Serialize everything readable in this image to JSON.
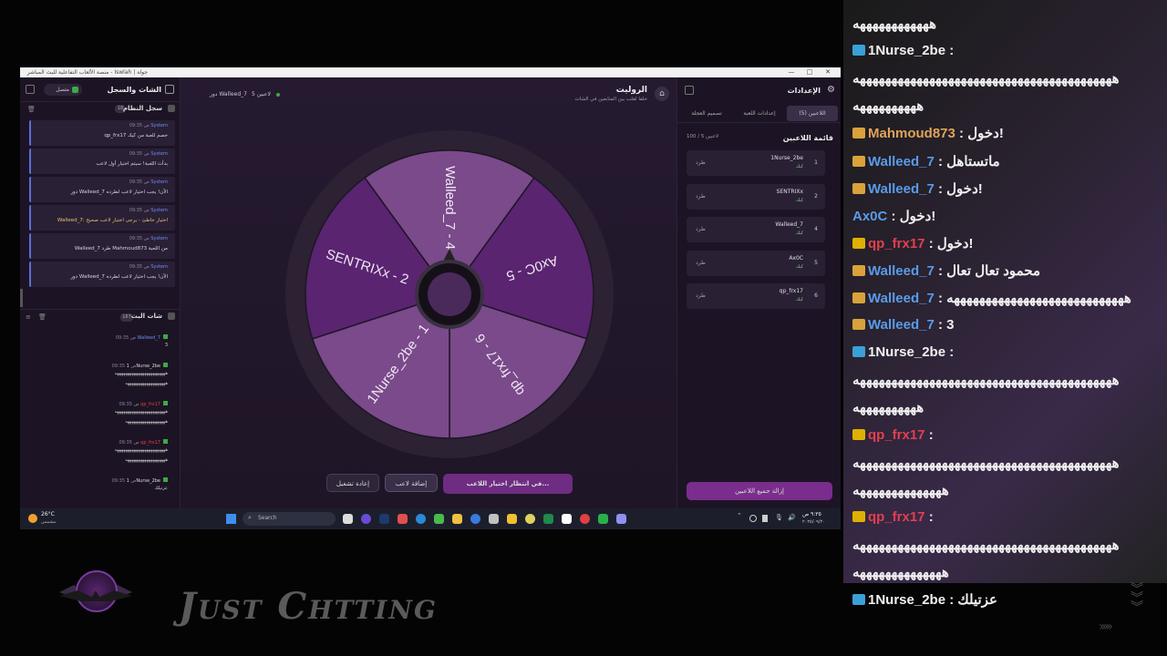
{
  "window": {
    "title": "منصة الألعاب التفاعلية للبث المباشر - Iswlah | جولة",
    "min": "—",
    "max": "□",
    "close": "✕"
  },
  "left": {
    "chat_title": "الشات والسجل",
    "status": "متصل",
    "system_log_title": "سجل النظام",
    "system_log_count": "18",
    "logs": [
      {
        "src": "System",
        "time": "09:35 ص",
        "msg": "qp_frx17 خصم للعبة من كيك"
      },
      {
        "src": "System",
        "time": "09:35 ص",
        "msg": "بدأت اللعبة! سيتم اختيار أول لاعب"
      },
      {
        "src": "System",
        "time": "09:35 ص",
        "msg": "دور Walleed_7 الآن! يجب اختيار لاعب لطرده"
      },
      {
        "src": "System",
        "time": "09:35 ص",
        "msg": "Walleed_7: اختيار خاطئ - يرجى اختيار لاعب صحيح"
      },
      {
        "src": "System",
        "time": "09:35 ص",
        "msg": "Walleed_7 طرد Mahmoud873 من اللعبة"
      },
      {
        "src": "System",
        "time": "09:35 ص",
        "msg": "دور Walleed_7 الآن! يجب اختيار لاعب لطرده"
      }
    ],
    "bot_chat_title": "شات البث",
    "bot_chat_count": "167",
    "chats": [
      {
        "user": "Walleed_7",
        "time": "09:35 ص",
        "lines": [
          "3"
        ]
      },
      {
        "user": "1Nurse_2be",
        "time": "09:35 ص",
        "lines": [
          "ههههههههههههههههههههههههه",
          "هههههههههههههههههههه"
        ]
      },
      {
        "user": "qp_frx17",
        "time": "09:35 ص",
        "lines": [
          "ههههههههههههههههههههههههه",
          "هههههههههههههههههههه"
        ]
      },
      {
        "user": "qp_frx17",
        "time": "09:35 ص",
        "lines": [
          "ههههههههههههههههههههههههه",
          "هههههههههههههههههههه"
        ]
      },
      {
        "user": "1Nurse_2be",
        "time": "09:35 ص",
        "lines": [
          "عزتيلك"
        ]
      }
    ]
  },
  "center": {
    "title": "الروليت",
    "subtitle": "خلفا لقلب بين المتابعين في الشات",
    "players_online": "5 لاعبين",
    "turn": "دور Walleed_7",
    "wheel_segments": [
      "Walleed_7 - 4",
      "Ax0C - 5",
      "qp_frx17 - 6",
      "1Nurse_2be - 1",
      "SENTRIXx - 2"
    ],
    "btn_restart": "إعادة تشغيل",
    "btn_add": "إضافة لاعب",
    "btn_waiting": "في انتظار اختيار اللاعب..."
  },
  "right": {
    "settings_title": "الإعدادات",
    "tabs": [
      "اللاعبين (5)",
      "إعدادات اللعبة",
      "تصميم العجلة"
    ],
    "list_title": "قائمة اللاعبين",
    "list_count": "100 / 5 لاعبين",
    "players": [
      {
        "idx": "1",
        "name": "1Nurse_2be",
        "src": "كيك",
        "kick": "طرد"
      },
      {
        "idx": "2",
        "name": "SENTRIXx",
        "src": "كيك",
        "kick": "طرد"
      },
      {
        "idx": "4",
        "name": "Walleed_7",
        "src": "كيك",
        "kick": "طرد"
      },
      {
        "idx": "5",
        "name": "Ax0C",
        "src": "كيك",
        "kick": "طرد"
      },
      {
        "idx": "6",
        "name": "qp_frx17",
        "src": "كيك",
        "kick": "طرد"
      }
    ],
    "remove_all": "إزالة جميع اللاعبين"
  },
  "taskbar": {
    "weather_temp": "26°C",
    "weather_desc": "مشمس",
    "search": "Search",
    "time": "٩:٣٥ ص",
    "date": "٢٠٢٥/٠٩/٢٠"
  },
  "stream_chat": [
    {
      "user": "",
      "text": "ههههههههههههه",
      "color": "#f0f0f0"
    },
    {
      "user": "1Nurse_2be",
      "text": "",
      "color": "#f0f0f0",
      "badge": "kick"
    },
    {
      "user": "",
      "text": "هههههههههههههههههههههههههههههههههههههههههه",
      "color": "#f0f0f0"
    },
    {
      "user": "",
      "text": "ههههههههههه",
      "color": "#f0f0f0"
    },
    {
      "user": "Mahmoud873",
      "text": "دخول!",
      "color": "#e0a35a",
      "badge": "crown"
    },
    {
      "user": "Walleed_7",
      "text": "ماتستاهل",
      "color": "#5a9be8",
      "badge": "crown"
    },
    {
      "user": "Walleed_7",
      "text": "دخول!",
      "color": "#5a9be8",
      "badge": "crown"
    },
    {
      "user": "Ax0C",
      "text": "دخول!",
      "color": "#5a9be8"
    },
    {
      "user": "qp_frx17",
      "text": "دخول!",
      "color": "#e04050",
      "badge": "sub"
    },
    {
      "user": "Walleed_7",
      "text": "محمود تعال تعال",
      "color": "#5a9be8",
      "badge": "crown"
    },
    {
      "user": "Walleed_7",
      "text": "ههههههههههههههههههههههههههههه",
      "color": "#5a9be8",
      "badge": "crown"
    },
    {
      "user": "Walleed_7",
      "text": "3",
      "color": "#5a9be8",
      "badge": "crown"
    },
    {
      "user": "1Nurse_2be",
      "text": "",
      "color": "#f0f0f0",
      "badge": "kick"
    },
    {
      "user": "",
      "text": "هههههههههههههههههههههههههههههههههههههههههه",
      "color": "#f0f0f0"
    },
    {
      "user": "",
      "text": "ههههههههههه",
      "color": "#f0f0f0"
    },
    {
      "user": "qp_frx17",
      "text": "",
      "color": "#e04050",
      "badge": "sub"
    },
    {
      "user": "",
      "text": "هههههههههههههههههههههههههههههههههههههههههه",
      "color": "#f0f0f0"
    },
    {
      "user": "",
      "text": "ههههههههههههههه",
      "color": "#f0f0f0"
    },
    {
      "user": "qp_frx17",
      "text": "",
      "color": "#e04050",
      "badge": "sub"
    },
    {
      "user": "",
      "text": "هههههههههههههههههههههههههههههههههههههههههه",
      "color": "#f0f0f0"
    },
    {
      "user": "",
      "text": "ههههههههههههههه",
      "color": "#f0f0f0"
    },
    {
      "user": "1Nurse_2be",
      "text": "عزتيلك",
      "color": "#f0f0f0",
      "badge": "kick"
    }
  ],
  "overlay": {
    "category": "Just Chtting"
  },
  "colors": {
    "accent": "#7a2d8c",
    "wheel_dark": "#5a2470",
    "wheel_light": "#7a4a8a"
  }
}
